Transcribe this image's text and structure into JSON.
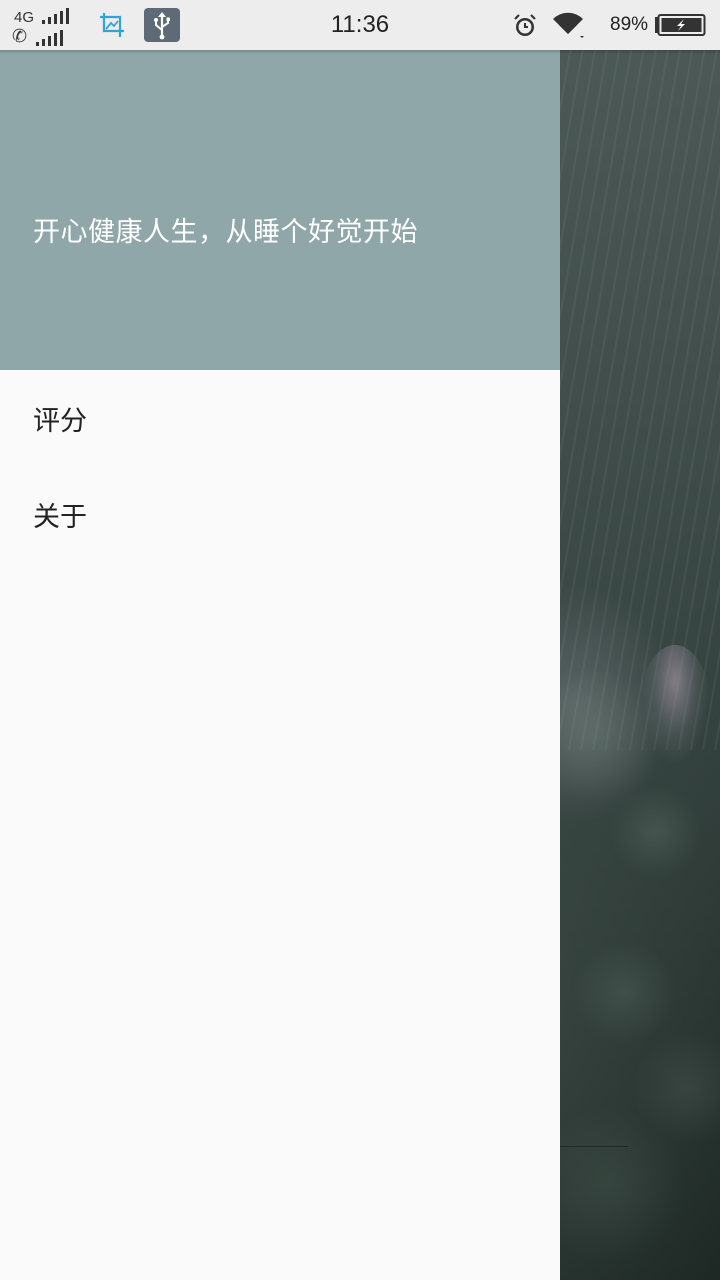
{
  "status_bar": {
    "network_type": "4G",
    "time": "11:36",
    "battery_percent": "89%",
    "icons": [
      "signal-icon",
      "phone-signal-icon",
      "screenshot-crop-icon",
      "usb-icon",
      "alarm-icon",
      "wifi-icon",
      "battery-charging-icon"
    ]
  },
  "drawer": {
    "header": {
      "tagline": "开心健康人生，从睡个好觉开始",
      "background_color": "#8fa7a8"
    },
    "menu": [
      {
        "label": "评分"
      },
      {
        "label": "关于"
      }
    ]
  }
}
